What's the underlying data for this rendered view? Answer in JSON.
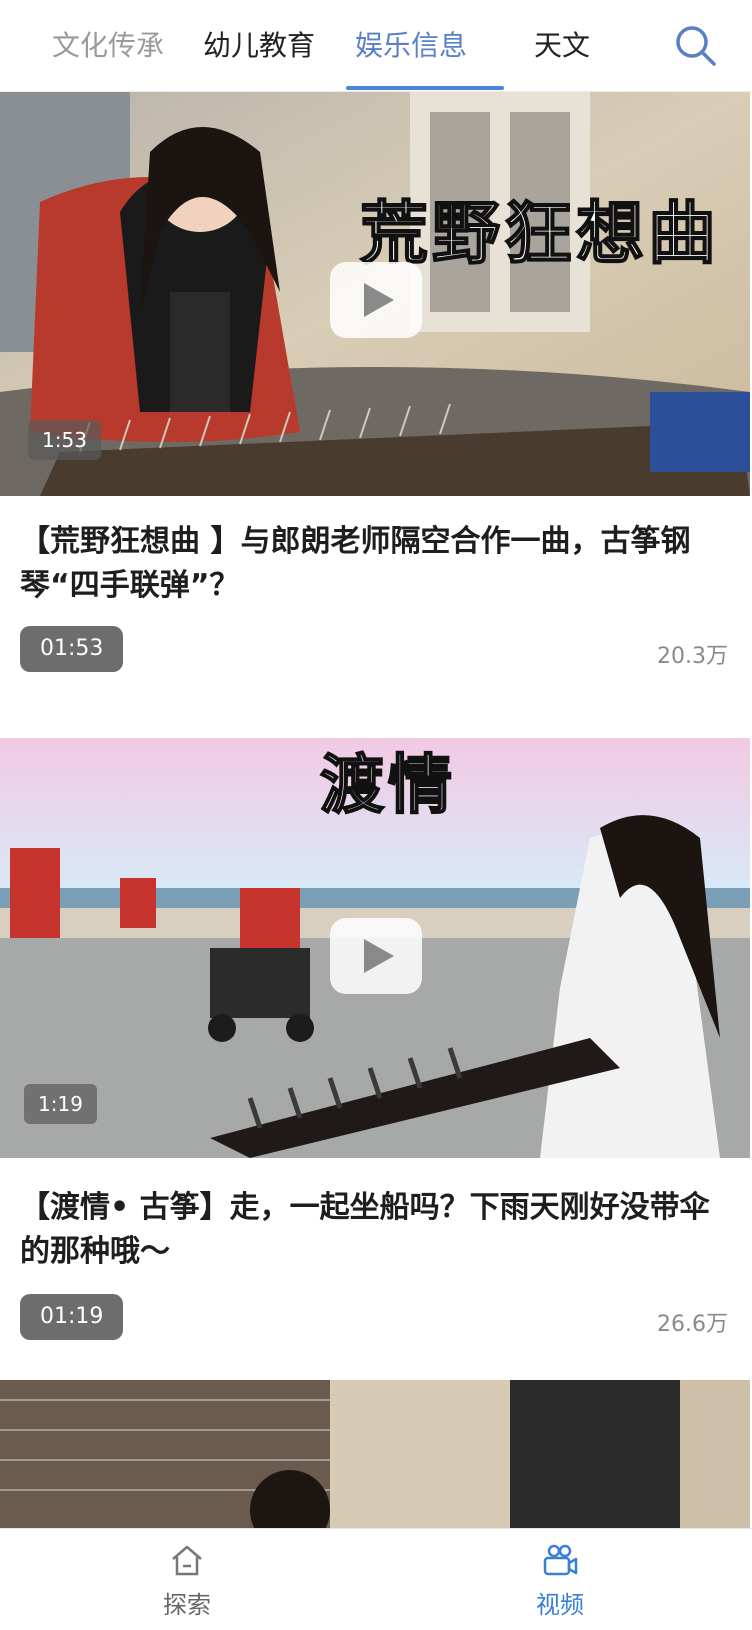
{
  "tabs": [
    {
      "label": "文化传承",
      "state": "faded"
    },
    {
      "label": "幼儿教育",
      "state": "normal"
    },
    {
      "label": "娱乐信息",
      "state": "active"
    },
    {
      "label": "天文",
      "state": "normal"
    }
  ],
  "icons": {
    "search": "search-icon",
    "play": "play-icon",
    "explore": "home-icon",
    "video": "video-users-icon"
  },
  "colors": {
    "accent": "#4a86d8",
    "active_tab": "#5a7fc8",
    "badge_bg": "#6d6d6d"
  },
  "videos": [
    {
      "overlay_text": "荒野狂想曲",
      "overlay_duration": "1:53",
      "title": "【荒野狂想曲 】与郎朗老师隔空合作一曲，古筝钢琴“四手联弹”？",
      "duration": "01:53",
      "views": "20.3万"
    },
    {
      "overlay_text": "渡情",
      "overlay_duration": "1:19",
      "title": "【渡情• 古筝】走，一起坐船吗？下雨天刚好没带伞的那种哦～",
      "duration": "01:19",
      "views": "26.6万"
    }
  ],
  "bottom_nav": [
    {
      "label": "探索",
      "active": false
    },
    {
      "label": "视频",
      "active": true
    }
  ]
}
